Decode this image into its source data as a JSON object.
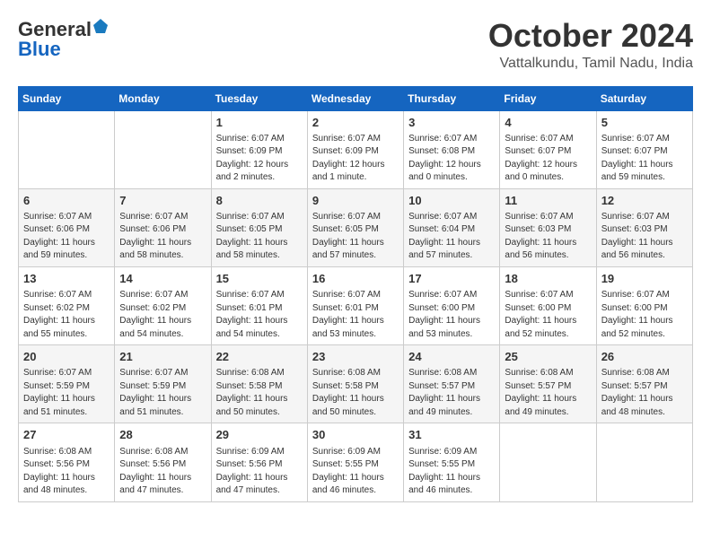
{
  "logo": {
    "part1": "General",
    "part2": "Blue"
  },
  "title": "October 2024",
  "location": "Vattalkundu, Tamil Nadu, India",
  "days_of_week": [
    "Sunday",
    "Monday",
    "Tuesday",
    "Wednesday",
    "Thursday",
    "Friday",
    "Saturday"
  ],
  "weeks": [
    [
      {
        "day": "",
        "info": ""
      },
      {
        "day": "",
        "info": ""
      },
      {
        "day": "1",
        "info": "Sunrise: 6:07 AM\nSunset: 6:09 PM\nDaylight: 12 hours\nand 2 minutes."
      },
      {
        "day": "2",
        "info": "Sunrise: 6:07 AM\nSunset: 6:09 PM\nDaylight: 12 hours\nand 1 minute."
      },
      {
        "day": "3",
        "info": "Sunrise: 6:07 AM\nSunset: 6:08 PM\nDaylight: 12 hours\nand 0 minutes."
      },
      {
        "day": "4",
        "info": "Sunrise: 6:07 AM\nSunset: 6:07 PM\nDaylight: 12 hours\nand 0 minutes."
      },
      {
        "day": "5",
        "info": "Sunrise: 6:07 AM\nSunset: 6:07 PM\nDaylight: 11 hours\nand 59 minutes."
      }
    ],
    [
      {
        "day": "6",
        "info": "Sunrise: 6:07 AM\nSunset: 6:06 PM\nDaylight: 11 hours\nand 59 minutes."
      },
      {
        "day": "7",
        "info": "Sunrise: 6:07 AM\nSunset: 6:06 PM\nDaylight: 11 hours\nand 58 minutes."
      },
      {
        "day": "8",
        "info": "Sunrise: 6:07 AM\nSunset: 6:05 PM\nDaylight: 11 hours\nand 58 minutes."
      },
      {
        "day": "9",
        "info": "Sunrise: 6:07 AM\nSunset: 6:05 PM\nDaylight: 11 hours\nand 57 minutes."
      },
      {
        "day": "10",
        "info": "Sunrise: 6:07 AM\nSunset: 6:04 PM\nDaylight: 11 hours\nand 57 minutes."
      },
      {
        "day": "11",
        "info": "Sunrise: 6:07 AM\nSunset: 6:03 PM\nDaylight: 11 hours\nand 56 minutes."
      },
      {
        "day": "12",
        "info": "Sunrise: 6:07 AM\nSunset: 6:03 PM\nDaylight: 11 hours\nand 56 minutes."
      }
    ],
    [
      {
        "day": "13",
        "info": "Sunrise: 6:07 AM\nSunset: 6:02 PM\nDaylight: 11 hours\nand 55 minutes."
      },
      {
        "day": "14",
        "info": "Sunrise: 6:07 AM\nSunset: 6:02 PM\nDaylight: 11 hours\nand 54 minutes."
      },
      {
        "day": "15",
        "info": "Sunrise: 6:07 AM\nSunset: 6:01 PM\nDaylight: 11 hours\nand 54 minutes."
      },
      {
        "day": "16",
        "info": "Sunrise: 6:07 AM\nSunset: 6:01 PM\nDaylight: 11 hours\nand 53 minutes."
      },
      {
        "day": "17",
        "info": "Sunrise: 6:07 AM\nSunset: 6:00 PM\nDaylight: 11 hours\nand 53 minutes."
      },
      {
        "day": "18",
        "info": "Sunrise: 6:07 AM\nSunset: 6:00 PM\nDaylight: 11 hours\nand 52 minutes."
      },
      {
        "day": "19",
        "info": "Sunrise: 6:07 AM\nSunset: 6:00 PM\nDaylight: 11 hours\nand 52 minutes."
      }
    ],
    [
      {
        "day": "20",
        "info": "Sunrise: 6:07 AM\nSunset: 5:59 PM\nDaylight: 11 hours\nand 51 minutes."
      },
      {
        "day": "21",
        "info": "Sunrise: 6:07 AM\nSunset: 5:59 PM\nDaylight: 11 hours\nand 51 minutes."
      },
      {
        "day": "22",
        "info": "Sunrise: 6:08 AM\nSunset: 5:58 PM\nDaylight: 11 hours\nand 50 minutes."
      },
      {
        "day": "23",
        "info": "Sunrise: 6:08 AM\nSunset: 5:58 PM\nDaylight: 11 hours\nand 50 minutes."
      },
      {
        "day": "24",
        "info": "Sunrise: 6:08 AM\nSunset: 5:57 PM\nDaylight: 11 hours\nand 49 minutes."
      },
      {
        "day": "25",
        "info": "Sunrise: 6:08 AM\nSunset: 5:57 PM\nDaylight: 11 hours\nand 49 minutes."
      },
      {
        "day": "26",
        "info": "Sunrise: 6:08 AM\nSunset: 5:57 PM\nDaylight: 11 hours\nand 48 minutes."
      }
    ],
    [
      {
        "day": "27",
        "info": "Sunrise: 6:08 AM\nSunset: 5:56 PM\nDaylight: 11 hours\nand 48 minutes."
      },
      {
        "day": "28",
        "info": "Sunrise: 6:08 AM\nSunset: 5:56 PM\nDaylight: 11 hours\nand 47 minutes."
      },
      {
        "day": "29",
        "info": "Sunrise: 6:09 AM\nSunset: 5:56 PM\nDaylight: 11 hours\nand 47 minutes."
      },
      {
        "day": "30",
        "info": "Sunrise: 6:09 AM\nSunset: 5:55 PM\nDaylight: 11 hours\nand 46 minutes."
      },
      {
        "day": "31",
        "info": "Sunrise: 6:09 AM\nSunset: 5:55 PM\nDaylight: 11 hours\nand 46 minutes."
      },
      {
        "day": "",
        "info": ""
      },
      {
        "day": "",
        "info": ""
      }
    ]
  ]
}
